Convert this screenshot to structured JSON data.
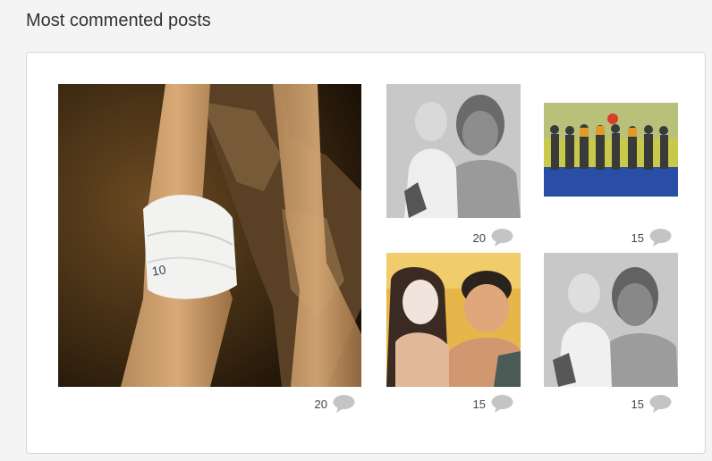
{
  "section": {
    "title": "Most commented posts"
  },
  "posts": [
    {
      "id": "p1",
      "comments": "20",
      "alt": "bandaged knee"
    },
    {
      "id": "p2",
      "comments": "20",
      "alt": "black and white photo man with child"
    },
    {
      "id": "p3",
      "comments": "15",
      "alt": "group photo in gym"
    },
    {
      "id": "p4",
      "comments": "15",
      "alt": "couple selfie"
    },
    {
      "id": "p5",
      "comments": "15",
      "alt": "black and white photo man with child"
    }
  ],
  "colors": {
    "comment_icon": "#c4c4c4",
    "count_text": "#444444",
    "card_border": "#d6d6d6"
  }
}
